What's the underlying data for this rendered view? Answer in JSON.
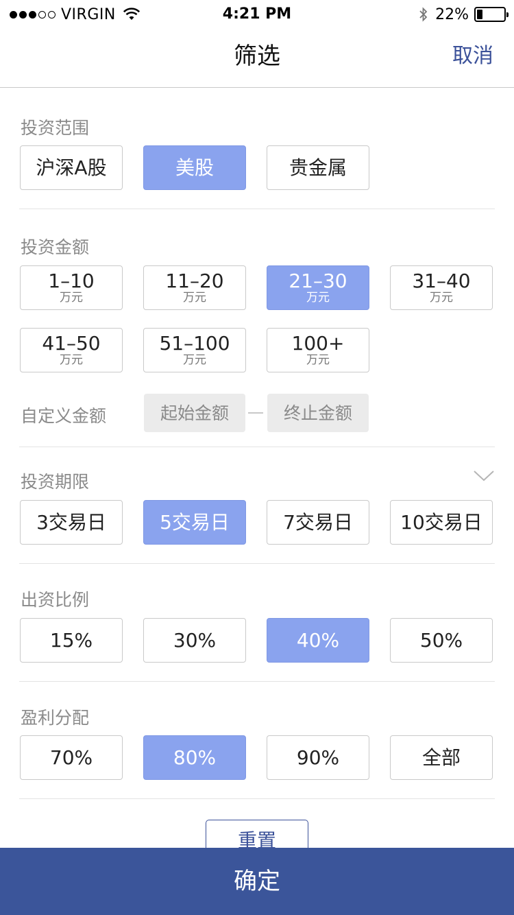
{
  "status_bar": {
    "carrier": "VIRGIN",
    "signal_bars_full": 3,
    "signal_bars_total": 5,
    "time": "4:21 PM",
    "battery_percent": "22%",
    "battery_level": 0.22
  },
  "nav": {
    "title": "筛选",
    "cancel": "取消"
  },
  "scope": {
    "title": "投资范围",
    "options": [
      {
        "label": "沪深A股",
        "selected": false
      },
      {
        "label": "美股",
        "selected": true
      },
      {
        "label": "贵金属",
        "selected": false
      }
    ]
  },
  "amount": {
    "title": "投资金额",
    "unit": "万元",
    "options": [
      {
        "label": "1–10",
        "selected": false
      },
      {
        "label": "11–20",
        "selected": false
      },
      {
        "label": "21–30",
        "selected": true
      },
      {
        "label": "31–40",
        "selected": false
      },
      {
        "label": "41–50",
        "selected": false
      },
      {
        "label": "51–100",
        "selected": false
      },
      {
        "label": "100+",
        "selected": false
      }
    ],
    "custom_label": "自定义金额",
    "start_placeholder": "起始金额",
    "end_placeholder": "终止金额"
  },
  "term": {
    "title": "投资期限",
    "options": [
      {
        "label": "3交易日",
        "selected": false
      },
      {
        "label": "5交易日",
        "selected": true
      },
      {
        "label": "7交易日",
        "selected": false
      },
      {
        "label": "10交易日",
        "selected": false
      }
    ]
  },
  "ratio": {
    "title": "出资比例",
    "options": [
      {
        "label": "15%",
        "selected": false
      },
      {
        "label": "30%",
        "selected": false
      },
      {
        "label": "40%",
        "selected": true
      },
      {
        "label": "50%",
        "selected": false
      }
    ]
  },
  "profit": {
    "title": "盈利分配",
    "options": [
      {
        "label": "70%",
        "selected": false
      },
      {
        "label": "80%",
        "selected": true
      },
      {
        "label": "90%",
        "selected": false
      },
      {
        "label": "全部",
        "selected": false
      }
    ]
  },
  "actions": {
    "reset": "重置",
    "confirm": "确定"
  },
  "colors": {
    "accent": "#3b5199",
    "selected_bg": "#8aa3ee",
    "confirm_bg": "#3b559a"
  },
  "icons": {
    "wifi": "wifi-icon",
    "bluetooth": "bluetooth-icon",
    "expand": "chevron-down-icon"
  }
}
